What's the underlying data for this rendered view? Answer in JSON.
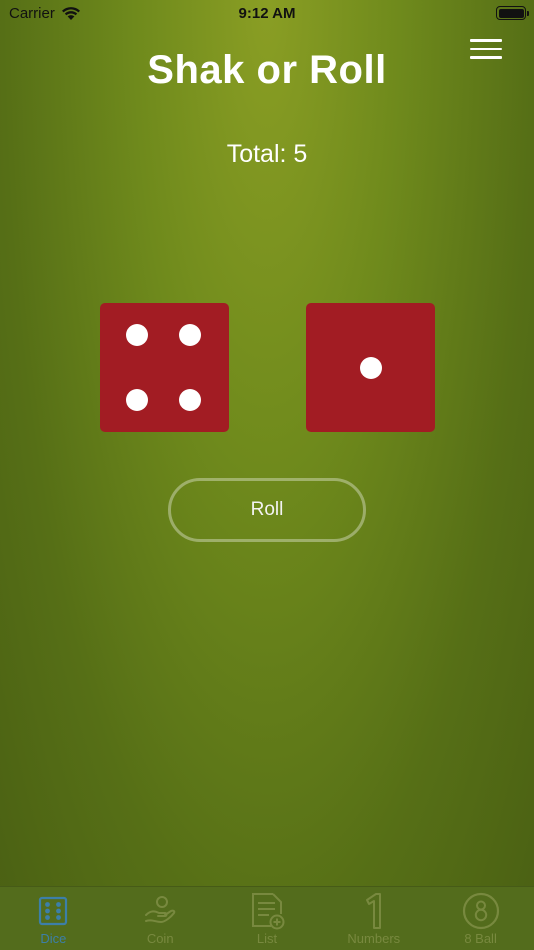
{
  "status": {
    "carrier": "Carrier",
    "time": "9:12 AM"
  },
  "header": {
    "title": "Shak or Roll"
  },
  "result": {
    "total_text": "Total: 5"
  },
  "dice": [
    {
      "value": 4
    },
    {
      "value": 1
    }
  ],
  "actions": {
    "roll_label": "Roll"
  },
  "tabs": [
    {
      "label": "Dice",
      "icon": "dice-icon",
      "active": true
    },
    {
      "label": "Coin",
      "icon": "coin-hand-icon",
      "active": false
    },
    {
      "label": "List",
      "icon": "list-add-icon",
      "active": false
    },
    {
      "label": "Numbers",
      "icon": "number-one-icon",
      "active": false
    },
    {
      "label": "8 Ball",
      "icon": "eight-ball-icon",
      "active": false
    }
  ],
  "colors": {
    "die": "#a21c23",
    "pip": "#ffffff",
    "tab_active": "#3c7fa8",
    "tab_inactive": "#78893f"
  }
}
